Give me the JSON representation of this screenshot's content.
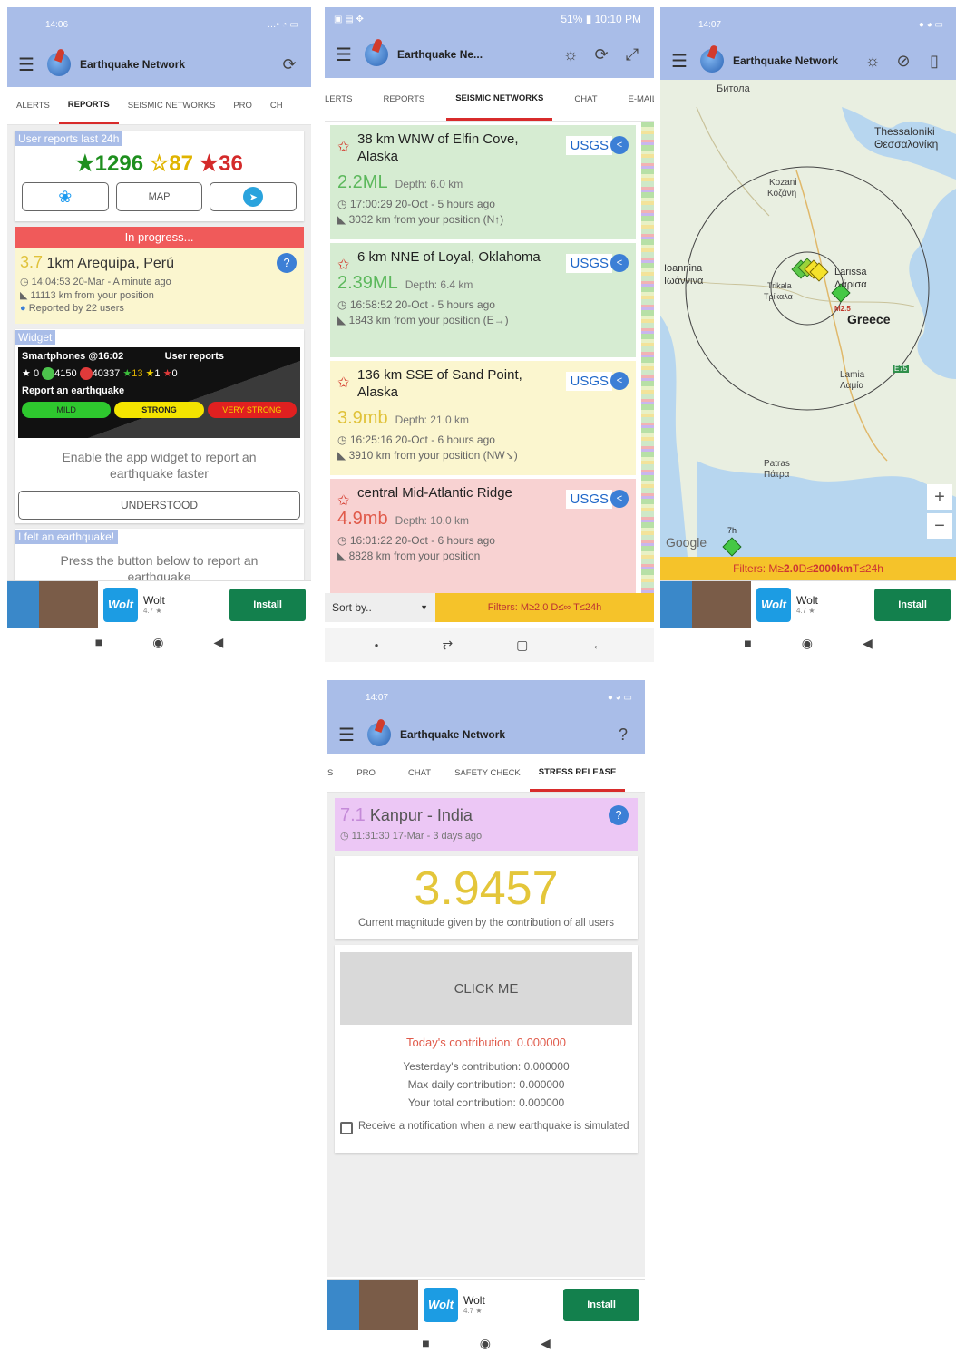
{
  "phone1": {
    "status_time": "14:06",
    "status_icons": "…• ◔ ▭",
    "app_title": "Earthquake Network",
    "refresh_icon": "refresh-icon",
    "tabs": [
      "ALERTS",
      "REPORTS",
      "SEISMIC NETWORKS",
      "PRO",
      "CH"
    ],
    "user_reports_label": "User reports last 24h",
    "count_green": "1296",
    "count_yellow": "87",
    "count_red": "36",
    "map_btn": "MAP",
    "in_progress": "In progress...",
    "progress_event": {
      "mag": "3.7",
      "place": "1km Arequipa, Perú",
      "time": "14:04:53 20-Mar - A minute ago",
      "distance": "11113 km from your position",
      "reported": "Reported by 22 users"
    },
    "widget_label": "Widget",
    "widget": {
      "smartphones": "Smartphones @16:02",
      "user_reports": "User reports",
      "s1": "0",
      "s2": "4150",
      "s3": "40337",
      "r1": "13",
      "r2": "1",
      "r3": "0",
      "report_title": "Report an earthquake",
      "mild": "MILD",
      "strong": "STRONG",
      "very_strong": "VERY STRONG"
    },
    "widget_hint": "Enable the app widget to report an earthquake faster",
    "understood": "UNDERSTOOD",
    "felt_label": "I felt an earthquake!",
    "felt_hint": "Press the button below to report an earthquake"
  },
  "phone2": {
    "status_left": "▣ ▤ ✥",
    "status_right": "51% ▮ 10:10 PM",
    "app_title": "Earthquake Ne...",
    "tabs": [
      "LERTS",
      "REPORTS",
      "SEISMIC NETWORKS",
      "CHAT",
      "E-MAILS"
    ],
    "quakes": [
      {
        "place": "38 km WNW of Elfin Cove, Alaska",
        "mag": "2.2ML",
        "depth": "Depth: 6.0 km",
        "time": "17:00:29 20-Oct - 5 hours ago",
        "distance": "3032 km from your position (N↑)",
        "source": "USGS",
        "color": "#d6ecd2",
        "magcolor": "#5cb85c"
      },
      {
        "place": "6 km NNE of Loyal, Oklahoma",
        "mag": "2.39ML",
        "depth": "Depth: 6.4 km",
        "time": "16:58:52 20-Oct - 5 hours ago",
        "distance": "1843 km from your position (E→)",
        "source": "USGS",
        "color": "#d6ecd2",
        "magcolor": "#5cb85c"
      },
      {
        "place": "136 km SSE of Sand Point, Alaska",
        "mag": "3.9mb",
        "depth": "Depth: 21.0 km",
        "time": "16:25:16 20-Oct - 6 hours ago",
        "distance": "3910 km from your position (NW↘)",
        "source": "USGS",
        "color": "#fbf6cf",
        "magcolor": "#e0c23a"
      },
      {
        "place": "central Mid-Atlantic Ridge",
        "mag": "4.9mb",
        "depth": "Depth: 10.0 km",
        "time": "16:01:22 20-Oct - 6 hours ago",
        "distance": "8828 km from your position",
        "source": "USGS",
        "color": "#f8d2d2",
        "magcolor": "#e05a4a"
      }
    ],
    "sort_by": "Sort by..",
    "filters": "Filters: M≥2.0 D≤∞ T≤24h"
  },
  "phone3": {
    "status_time": "14:07",
    "app_title": "Earthquake Network",
    "labels": {
      "bitola": "Битола",
      "thessaloniki": "Thessaloniki",
      "thessaloniki_gr": "Θεσσαλονίκη",
      "kozani": "Kozani",
      "kozani_gr": "Κοζάνη",
      "ioannina": "Ioannina",
      "ioannina_gr": "Ιωάννινα",
      "larissa": "Larissa",
      "larissa_gr": "Λάρισα",
      "trikala": "Trikala",
      "trikala_gr": "Τρίκαλα",
      "greece": "Greece",
      "lamia": "Lamia",
      "lamia_gr": "Λαμία",
      "patras": "Patras",
      "patras_gr": "Πάτρα",
      "m25": "M2.5",
      "t7h": "7h",
      "e75": "E75",
      "google": "Google"
    },
    "zoom_in": "+",
    "zoom_out": "−",
    "filters_prefix": "Filters: M≥",
    "filters_m": "2.0",
    "filters_d_prefix": " D≤",
    "filters_d": "2000km",
    "filters_t": " T≤24h"
  },
  "phone4": {
    "status_time": "14:07",
    "app_title": "Earthquake Network",
    "help_icon": "?",
    "tabs": [
      "S",
      "PRO",
      "CHAT",
      "SAFETY CHECK",
      "STRESS RELEASE"
    ],
    "event_mag": "7.1",
    "event_place": "Kanpur - India",
    "event_time": "11:31:30 17-Mar - 3 days ago",
    "big_value": "3.9457",
    "big_caption": "Current magnitude given by the contribution of all users",
    "click_me": "CLICK ME",
    "today": "Today's contribution: 0.000000",
    "yesterday": "Yesterday's contribution: 0.000000",
    "max_daily": "Max daily contribution: 0.000000",
    "total": "Your total contribution: 0.000000",
    "notify": "Receive a notification when a new earthquake is simulated"
  },
  "ad": {
    "name": "Wolt",
    "rating": "4.7 ★",
    "install": "Install",
    "logo": "Wolt"
  },
  "colors": {
    "accent": "#a9bde8",
    "tab_underline": "#d82b2b",
    "install": "#13804d",
    "green": "#1e8f1e",
    "yellow": "#e0b400",
    "red": "#d42a2a"
  }
}
